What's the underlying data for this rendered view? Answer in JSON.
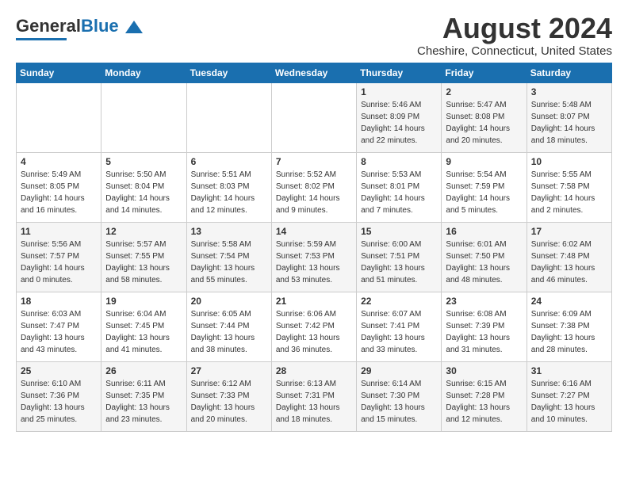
{
  "header": {
    "logo_general": "General",
    "logo_blue": "Blue",
    "month_title": "August 2024",
    "location": "Cheshire, Connecticut, United States"
  },
  "days_of_week": [
    "Sunday",
    "Monday",
    "Tuesday",
    "Wednesday",
    "Thursday",
    "Friday",
    "Saturday"
  ],
  "weeks": [
    [
      {
        "day": "",
        "info": ""
      },
      {
        "day": "",
        "info": ""
      },
      {
        "day": "",
        "info": ""
      },
      {
        "day": "",
        "info": ""
      },
      {
        "day": "1",
        "info": "Sunrise: 5:46 AM\nSunset: 8:09 PM\nDaylight: 14 hours\nand 22 minutes."
      },
      {
        "day": "2",
        "info": "Sunrise: 5:47 AM\nSunset: 8:08 PM\nDaylight: 14 hours\nand 20 minutes."
      },
      {
        "day": "3",
        "info": "Sunrise: 5:48 AM\nSunset: 8:07 PM\nDaylight: 14 hours\nand 18 minutes."
      }
    ],
    [
      {
        "day": "4",
        "info": "Sunrise: 5:49 AM\nSunset: 8:05 PM\nDaylight: 14 hours\nand 16 minutes."
      },
      {
        "day": "5",
        "info": "Sunrise: 5:50 AM\nSunset: 8:04 PM\nDaylight: 14 hours\nand 14 minutes."
      },
      {
        "day": "6",
        "info": "Sunrise: 5:51 AM\nSunset: 8:03 PM\nDaylight: 14 hours\nand 12 minutes."
      },
      {
        "day": "7",
        "info": "Sunrise: 5:52 AM\nSunset: 8:02 PM\nDaylight: 14 hours\nand 9 minutes."
      },
      {
        "day": "8",
        "info": "Sunrise: 5:53 AM\nSunset: 8:01 PM\nDaylight: 14 hours\nand 7 minutes."
      },
      {
        "day": "9",
        "info": "Sunrise: 5:54 AM\nSunset: 7:59 PM\nDaylight: 14 hours\nand 5 minutes."
      },
      {
        "day": "10",
        "info": "Sunrise: 5:55 AM\nSunset: 7:58 PM\nDaylight: 14 hours\nand 2 minutes."
      }
    ],
    [
      {
        "day": "11",
        "info": "Sunrise: 5:56 AM\nSunset: 7:57 PM\nDaylight: 14 hours\nand 0 minutes."
      },
      {
        "day": "12",
        "info": "Sunrise: 5:57 AM\nSunset: 7:55 PM\nDaylight: 13 hours\nand 58 minutes."
      },
      {
        "day": "13",
        "info": "Sunrise: 5:58 AM\nSunset: 7:54 PM\nDaylight: 13 hours\nand 55 minutes."
      },
      {
        "day": "14",
        "info": "Sunrise: 5:59 AM\nSunset: 7:53 PM\nDaylight: 13 hours\nand 53 minutes."
      },
      {
        "day": "15",
        "info": "Sunrise: 6:00 AM\nSunset: 7:51 PM\nDaylight: 13 hours\nand 51 minutes."
      },
      {
        "day": "16",
        "info": "Sunrise: 6:01 AM\nSunset: 7:50 PM\nDaylight: 13 hours\nand 48 minutes."
      },
      {
        "day": "17",
        "info": "Sunrise: 6:02 AM\nSunset: 7:48 PM\nDaylight: 13 hours\nand 46 minutes."
      }
    ],
    [
      {
        "day": "18",
        "info": "Sunrise: 6:03 AM\nSunset: 7:47 PM\nDaylight: 13 hours\nand 43 minutes."
      },
      {
        "day": "19",
        "info": "Sunrise: 6:04 AM\nSunset: 7:45 PM\nDaylight: 13 hours\nand 41 minutes."
      },
      {
        "day": "20",
        "info": "Sunrise: 6:05 AM\nSunset: 7:44 PM\nDaylight: 13 hours\nand 38 minutes."
      },
      {
        "day": "21",
        "info": "Sunrise: 6:06 AM\nSunset: 7:42 PM\nDaylight: 13 hours\nand 36 minutes."
      },
      {
        "day": "22",
        "info": "Sunrise: 6:07 AM\nSunset: 7:41 PM\nDaylight: 13 hours\nand 33 minutes."
      },
      {
        "day": "23",
        "info": "Sunrise: 6:08 AM\nSunset: 7:39 PM\nDaylight: 13 hours\nand 31 minutes."
      },
      {
        "day": "24",
        "info": "Sunrise: 6:09 AM\nSunset: 7:38 PM\nDaylight: 13 hours\nand 28 minutes."
      }
    ],
    [
      {
        "day": "25",
        "info": "Sunrise: 6:10 AM\nSunset: 7:36 PM\nDaylight: 13 hours\nand 25 minutes."
      },
      {
        "day": "26",
        "info": "Sunrise: 6:11 AM\nSunset: 7:35 PM\nDaylight: 13 hours\nand 23 minutes."
      },
      {
        "day": "27",
        "info": "Sunrise: 6:12 AM\nSunset: 7:33 PM\nDaylight: 13 hours\nand 20 minutes."
      },
      {
        "day": "28",
        "info": "Sunrise: 6:13 AM\nSunset: 7:31 PM\nDaylight: 13 hours\nand 18 minutes."
      },
      {
        "day": "29",
        "info": "Sunrise: 6:14 AM\nSunset: 7:30 PM\nDaylight: 13 hours\nand 15 minutes."
      },
      {
        "day": "30",
        "info": "Sunrise: 6:15 AM\nSunset: 7:28 PM\nDaylight: 13 hours\nand 12 minutes."
      },
      {
        "day": "31",
        "info": "Sunrise: 6:16 AM\nSunset: 7:27 PM\nDaylight: 13 hours\nand 10 minutes."
      }
    ]
  ]
}
